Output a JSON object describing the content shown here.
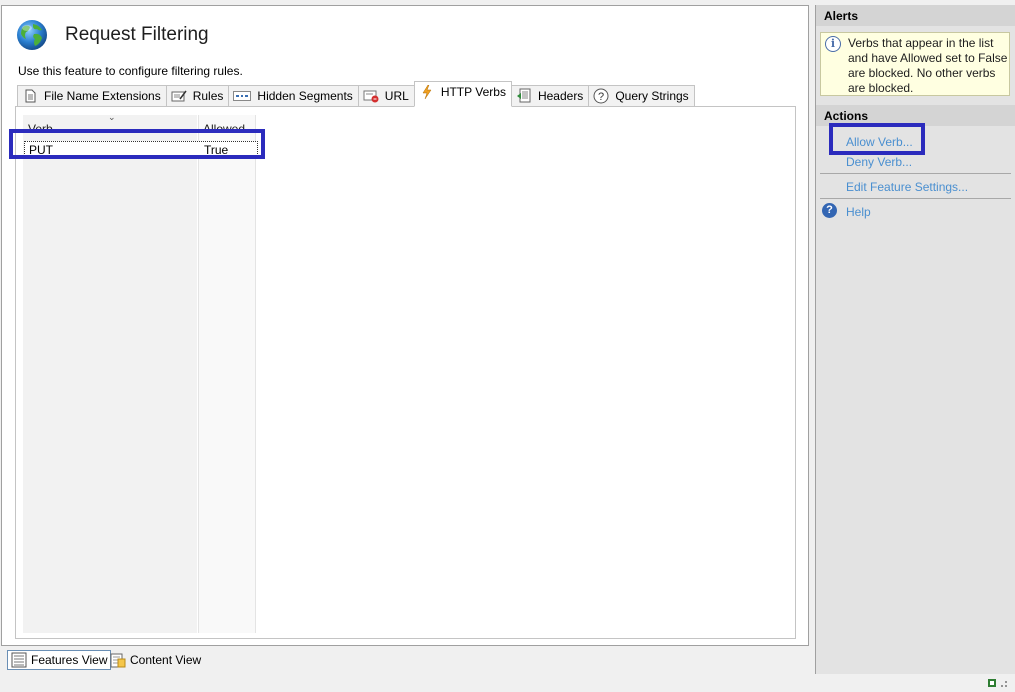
{
  "page": {
    "title": "Request Filtering",
    "description": "Use this feature to configure filtering rules."
  },
  "tabs": [
    {
      "label": "File Name Extensions",
      "icon": "document-icon"
    },
    {
      "label": "Rules",
      "icon": "edit-icon"
    },
    {
      "label": "Hidden Segments",
      "icon": "segments-icon"
    },
    {
      "label": "URL",
      "icon": "url-icon"
    },
    {
      "label": "HTTP Verbs",
      "icon": "lightning-icon",
      "active": true
    },
    {
      "label": "Headers",
      "icon": "headers-icon"
    },
    {
      "label": "Query Strings",
      "icon": "question-icon"
    }
  ],
  "list": {
    "columns": [
      "Verb",
      "Allowed"
    ],
    "rows": [
      {
        "verb": "PUT",
        "allowed": "True"
      }
    ]
  },
  "views": {
    "features": "Features View",
    "content": "Content View"
  },
  "alerts": {
    "header": "Alerts",
    "message": "Verbs that appear in the list and have Allowed set to False are blocked. No other verbs are blocked."
  },
  "actions": {
    "header": "Actions",
    "allow": "Allow Verb...",
    "deny": "Deny Verb...",
    "edit": "Edit Feature Settings...",
    "help": "Help"
  },
  "colors": {
    "highlight": "#2b2bbd",
    "link": "#4a8fd0",
    "alert_bg": "#ffffe1"
  }
}
